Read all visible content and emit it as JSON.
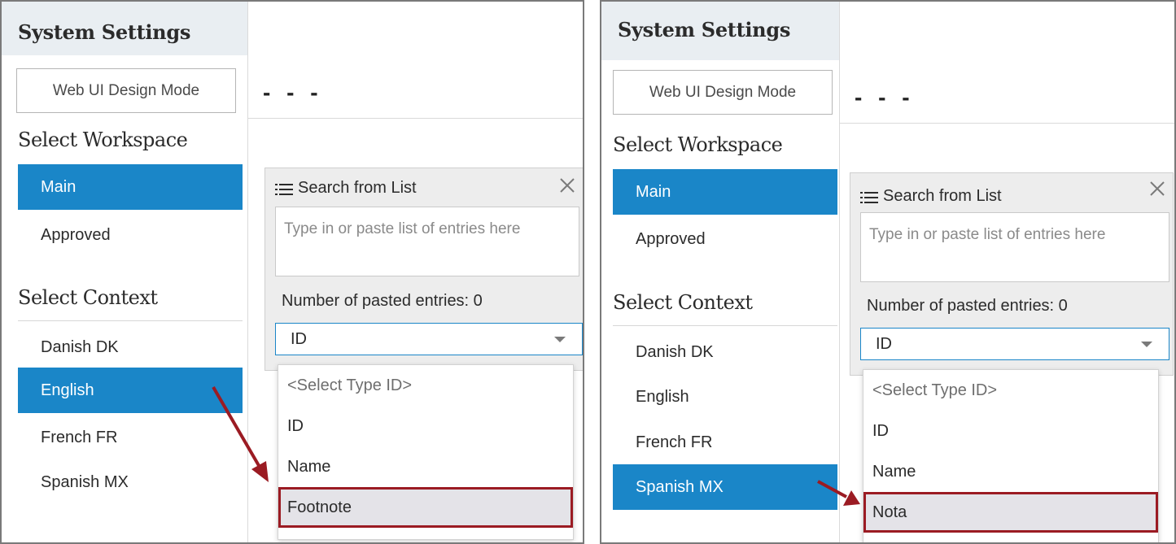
{
  "screens": [
    {
      "sidebar": {
        "title": "System Settings",
        "mode_button": "Web UI Design Mode",
        "workspace_heading": "Select Workspace",
        "workspaces": [
          {
            "label": "Main",
            "selected": true
          },
          {
            "label": "Approved",
            "selected": false
          }
        ],
        "context_heading": "Select Context",
        "contexts": [
          {
            "label": "Danish DK",
            "selected": false
          },
          {
            "label": "English",
            "selected": true
          },
          {
            "label": "French FR",
            "selected": false
          },
          {
            "label": "Spanish MX",
            "selected": false
          }
        ]
      },
      "main": {
        "placeholder_dashes": "- - -",
        "panel": {
          "title": "Search from List",
          "entry_placeholder": "Type in or paste list of entries here",
          "count_label": "Number of pasted entries: 0",
          "select_value": "ID",
          "options": [
            "<Select Type ID>",
            "ID",
            "Name",
            "Footnote"
          ],
          "highlighted_option": "Footnote"
        }
      }
    },
    {
      "sidebar": {
        "title": "System Settings",
        "mode_button": "Web UI Design Mode",
        "workspace_heading": "Select Workspace",
        "workspaces": [
          {
            "label": "Main",
            "selected": true
          },
          {
            "label": "Approved",
            "selected": false
          }
        ],
        "context_heading": "Select Context",
        "contexts": [
          {
            "label": "Danish DK",
            "selected": false
          },
          {
            "label": "English",
            "selected": false
          },
          {
            "label": "French FR",
            "selected": false
          },
          {
            "label": "Spanish MX",
            "selected": true
          }
        ]
      },
      "main": {
        "placeholder_dashes": "- - -",
        "panel": {
          "title": "Search from List",
          "entry_placeholder": "Type in or paste list of entries here",
          "count_label": "Number of pasted entries: 0",
          "select_value": "ID",
          "options": [
            "<Select Type ID>",
            "ID",
            "Name",
            "Nota"
          ],
          "highlighted_option": "Nota"
        }
      }
    }
  ],
  "colors": {
    "selected_bg": "#1a86c8",
    "header_bg": "#e9eef2",
    "highlight_border": "#9b1b23",
    "annotation_arrow": "#9b1b23"
  },
  "icons": [
    "list-icon",
    "close-icon",
    "chevron-down-icon",
    "annotation-arrow-icon"
  ]
}
